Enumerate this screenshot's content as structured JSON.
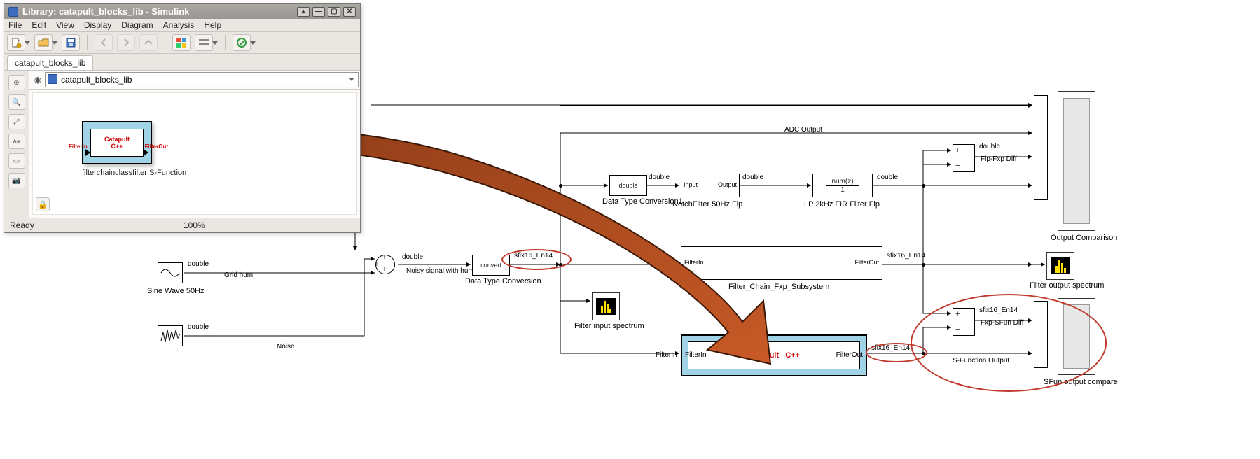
{
  "window": {
    "title": "Library: catapult_blocks_lib - Simulink",
    "menus": [
      "File",
      "Edit",
      "View",
      "Display",
      "Diagram",
      "Analysis",
      "Help"
    ],
    "tab": "catapult_blocks_lib",
    "path": "catapult_blocks_lib",
    "status_left": "Ready",
    "status_zoom": "100%"
  },
  "library_block": {
    "port_in": "FilterIn",
    "port_out": "FilterOut",
    "inner_top": "Catapult",
    "inner_bot": "C++",
    "name": "filterchainclassfilter S-Function"
  },
  "signals": {
    "double": "double",
    "sfix16": "sfix16_En14",
    "grid_hum": "Grid hum",
    "noise": "Noise",
    "noisy": "Noisy signal with hum",
    "adc": "ADC Output",
    "flpfxp": "Flp-Fxp Diff",
    "fxpsfun": "Fxp-SFun Diff",
    "sfun_out": "S-Function Output"
  },
  "blocks": {
    "sine": "Sine Wave 50Hz",
    "noise_src": "Noise",
    "sum": "Sum",
    "dtconv": {
      "text": "convert",
      "name": "Data Type Conversion"
    },
    "dtconv1": {
      "text": "double",
      "name": "Data Type Conversion1"
    },
    "notch": {
      "in": "Input",
      "out": "Output",
      "name": "NotchFilter 50Hz Flp"
    },
    "fir": {
      "num": "num(z)",
      "den": "1",
      "name": "LP 2kHz FIR Filter Flp"
    },
    "fxp_ss": {
      "in": "FilterIn",
      "out": "FilterOut",
      "name": "Filter_Chain_Fxp_Subsystem"
    },
    "sfun": {
      "in": "FilterIn",
      "out": "FilterOut",
      "inner_top": "Catapult",
      "inner_bot": "C++"
    },
    "spectrum_in": "Filter input spectrum",
    "spectrum_out": "Filter output spectrum",
    "out_compare": "Output Comparison",
    "sfun_compare": "SFun output compare"
  }
}
